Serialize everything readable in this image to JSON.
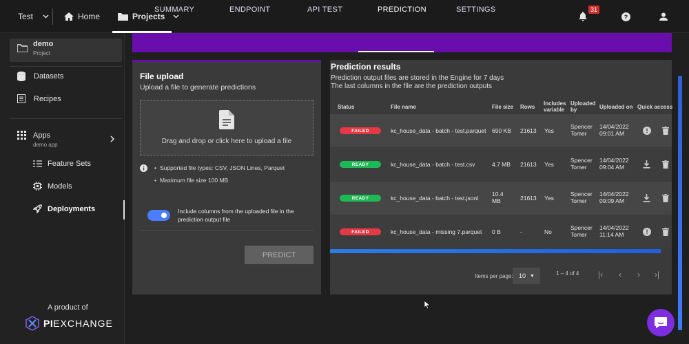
{
  "topbar": {
    "workspace": "Test",
    "home_label": "Home",
    "projects_label": "Projects",
    "notification_count": "31"
  },
  "sidebar": {
    "project_name": "demo",
    "project_type": "Project",
    "items": [
      {
        "label": "Datasets",
        "icon": "database-icon"
      },
      {
        "label": "Recipes",
        "icon": "list-icon"
      }
    ],
    "apps": {
      "label": "Apps",
      "sub": "demo app"
    },
    "app_items": [
      {
        "label": "Feature Sets",
        "icon": "feature-sets-icon"
      },
      {
        "label": "Models",
        "icon": "cpu-icon"
      },
      {
        "label": "Deployments",
        "icon": "rocket-icon",
        "active": true
      }
    ],
    "footer_text": "A product of",
    "brand_a": "PI",
    "brand_b": "EXCHANGE"
  },
  "tabs": [
    "SUMMARY",
    "ENDPOINT",
    "API TEST",
    "PREDICTION",
    "SETTINGS"
  ],
  "active_tab": "PREDICTION",
  "upload": {
    "title": "File upload",
    "subtitle": "Upload a file to generate predictions",
    "dropzone_text": "Drag and drop or click here to upload a file",
    "info_1": "Supported file types: CSV, JSON Lines, Parquet",
    "info_2": "Maximum file size 100 MB",
    "toggle_label_1": "Include columns from the uploaded file in the",
    "toggle_label_2": "prediction output file",
    "toggle_on": true,
    "predict_label": "PREDICT"
  },
  "results": {
    "title": "Prediction results",
    "desc_1": "Prediction output files are stored in the Engine for 7 days",
    "desc_2": "The last columns in the file are the prediction outputs",
    "headers": {
      "status": "Status",
      "file_name": "File name",
      "file_size": "File size",
      "rows": "Rows",
      "includes_1": "Includes",
      "includes_2": "variable",
      "uploaded_by_1": "Uploaded",
      "uploaded_by_2": "by",
      "uploaded_on": "Uploaded on",
      "quick_access": "Quick access"
    },
    "rows": [
      {
        "status": "FAILED",
        "file": "kc_house_data - batch - test.parquet",
        "size_1": "690 KB",
        "size_2": "",
        "rows": "21613",
        "includes": "Yes",
        "by_1": "Spencer",
        "by_2": "Tomer",
        "date": "14/04/2022",
        "time": "09:01 AM",
        "action": "info-icon"
      },
      {
        "status": "READY",
        "file": "kc_house_data - batch - test.csv",
        "size_1": "4.7 MB",
        "size_2": "",
        "rows": "21613",
        "includes": "Yes",
        "by_1": "Spencer",
        "by_2": "Tomer",
        "date": "14/04/2022",
        "time": "09:04 AM",
        "action": "download-icon"
      },
      {
        "status": "READY",
        "file": "kc_house_data - batch - test.jsonl",
        "size_1": "10.4",
        "size_2": "MB",
        "rows": "21613",
        "includes": "Yes",
        "by_1": "Spencer",
        "by_2": "Tomer",
        "date": "14/04/2022",
        "time": "09:09 AM",
        "action": "download-icon"
      },
      {
        "status": "FAILED",
        "file": "kc_house_data - missing 7.parquet",
        "size_1": "0 B",
        "size_2": "",
        "rows": "-",
        "includes": "No",
        "by_1": "Spencer",
        "by_2": "Tomer",
        "date": "14/04/2022",
        "time": "11:14 AM",
        "action": "info-icon"
      }
    ],
    "items_per_page_label": "Items per page:",
    "items_per_page": "10",
    "range": "1 – 4 of 4"
  },
  "colors": {
    "accent": "#6a0dad",
    "failed": "#e53945",
    "ready": "#1db954",
    "toggle": "#4a7dff",
    "chat": "#7c2ee0"
  }
}
